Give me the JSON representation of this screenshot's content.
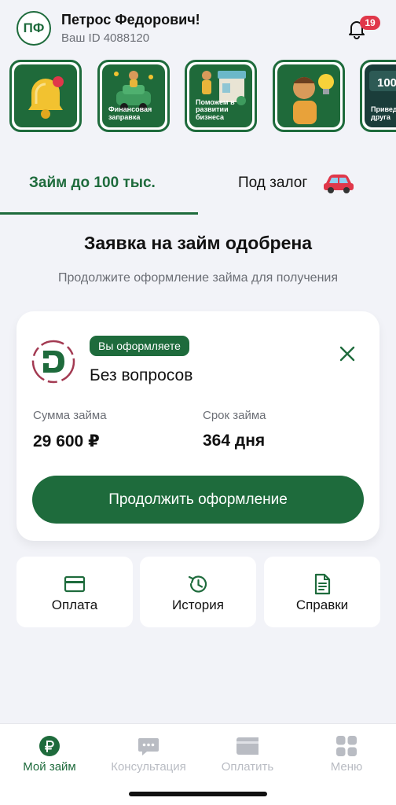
{
  "header": {
    "avatar_initials": "ПФ",
    "user_name": "Петрос Федорович!",
    "user_id": "Ваш ID 4088120",
    "notifications_count": "19",
    "bell_icon": "bell-icon"
  },
  "stories": [
    {
      "label": "",
      "icon": "bell-icon"
    },
    {
      "label": "Финансовая заправка",
      "icon": "car-fuel-illustration"
    },
    {
      "label": "Поможем в развитии бизнеса",
      "icon": "business-illustration"
    },
    {
      "label": "",
      "icon": "lightbulb-illustration"
    },
    {
      "label": "Приведи друга",
      "badge": "100",
      "icon": "referral-illustration"
    }
  ],
  "tabs": {
    "loan": "Займ до 100 тыс.",
    "collateral": "Под залог",
    "active": "loan"
  },
  "main": {
    "title": "Заявка на займ одобрена",
    "subtitle": "Продолжите оформление займа для получения"
  },
  "loan_card": {
    "badge": "Вы оформляете",
    "product": "Без вопросов",
    "sum_label": "Сумма займа",
    "sum_value": "29 600 ₽",
    "term_label": "Срок займа",
    "term_value": "364 дня",
    "continue": "Продолжить оформление"
  },
  "actions": [
    {
      "label": "Оплата",
      "icon": "credit-card-icon"
    },
    {
      "label": "История",
      "icon": "history-icon"
    },
    {
      "label": "Справки",
      "icon": "document-icon"
    }
  ],
  "bottom_nav": [
    {
      "label": "Мой займ",
      "icon": "ruble-icon",
      "active": true
    },
    {
      "label": "Консультация",
      "icon": "chat-icon",
      "active": false
    },
    {
      "label": "Оплатить",
      "icon": "card-icon",
      "active": false
    },
    {
      "label": "Меню",
      "icon": "grid-icon",
      "active": false
    }
  ],
  "colors": {
    "brand_green": "#1e6b3c",
    "badge_red": "#e0374a",
    "background": "#f2f3f8",
    "muted_text": "#6b6e75",
    "inactive_nav": "#b9bcc3"
  }
}
